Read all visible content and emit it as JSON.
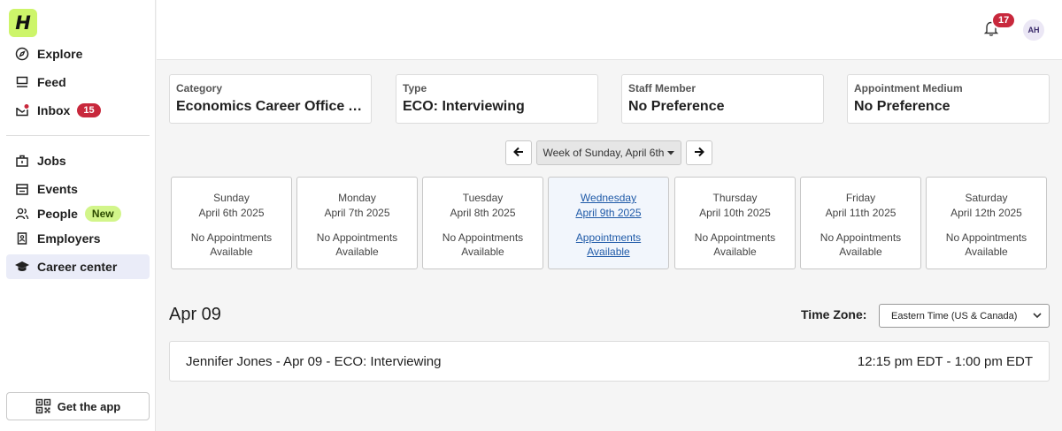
{
  "sidebar": {
    "logo": "H",
    "items": [
      {
        "label": "Explore",
        "icon": "compass-icon"
      },
      {
        "label": "Feed",
        "icon": "feed-icon"
      },
      {
        "label": "Inbox",
        "icon": "inbox-icon",
        "badge": "15"
      },
      {
        "label": "Jobs",
        "icon": "briefcase-icon"
      },
      {
        "label": "Events",
        "icon": "calendar-icon"
      },
      {
        "label": "People",
        "icon": "people-icon",
        "badge": "New"
      },
      {
        "label": "Employers",
        "icon": "building-icon"
      },
      {
        "label": "Career center",
        "icon": "graduation-cap-icon",
        "active": true
      }
    ],
    "get_app": "Get the app"
  },
  "header": {
    "notification_count": "17",
    "avatar_initials": "AH"
  },
  "filters": [
    {
      "label": "Category",
      "value": "Economics Career Office Appointments"
    },
    {
      "label": "Type",
      "value": "ECO: Interviewing"
    },
    {
      "label": "Staff Member",
      "value": "No Preference"
    },
    {
      "label": "Appointment Medium",
      "value": "No Preference"
    }
  ],
  "week_nav": {
    "label": "Week of Sunday, April 6th"
  },
  "days": [
    {
      "day": "Sunday",
      "date": "April 6th 2025",
      "availability": [
        "No Appointments",
        "Available"
      ]
    },
    {
      "day": "Monday",
      "date": "April 7th 2025",
      "availability": [
        "No Appointments",
        "Available"
      ]
    },
    {
      "day": "Tuesday",
      "date": "April 8th 2025",
      "availability": [
        "No Appointments",
        "Available"
      ]
    },
    {
      "day": "Wednesday",
      "date": "April 9th 2025",
      "availability": [
        "Appointments",
        "Available"
      ],
      "selected": true
    },
    {
      "day": "Thursday",
      "date": "April 10th 2025",
      "availability": [
        "No Appointments",
        "Available"
      ]
    },
    {
      "day": "Friday",
      "date": "April 11th 2025",
      "availability": [
        "No Appointments",
        "Available"
      ]
    },
    {
      "day": "Saturday",
      "date": "April 12th 2025",
      "availability": [
        "No Appointments",
        "Available"
      ]
    }
  ],
  "selected_date": "Apr 09",
  "timezone": {
    "label": "Time Zone:",
    "value": "Eastern Time (US & Canada)"
  },
  "appointments": [
    {
      "title": "Jennifer Jones - Apr 09 - ECO: Interviewing",
      "time": "12:15 pm EDT - 1:00 pm EDT"
    }
  ],
  "colors": {
    "accent_red": "#c8283c",
    "logo_green": "#cdf56a",
    "link_blue": "#1f5aa8"
  }
}
